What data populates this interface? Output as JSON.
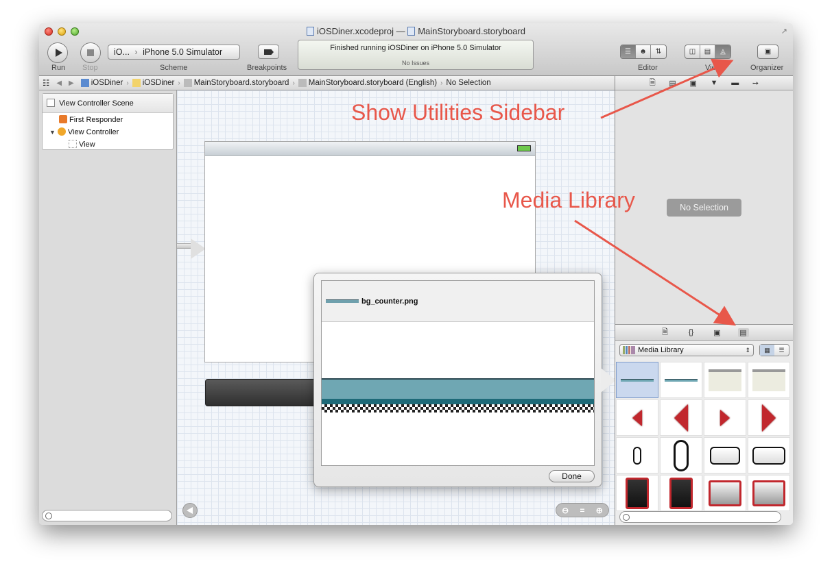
{
  "window": {
    "title_project": "iOSDiner.xcodeproj",
    "title_separator": "—",
    "title_file": "MainStoryboard.storyboard"
  },
  "toolbar": {
    "run_label": "Run",
    "stop_label": "Stop",
    "scheme_target": "iO...",
    "scheme_device": "iPhone 5.0 Simulator",
    "scheme_label": "Scheme",
    "breakpoints_label": "Breakpoints",
    "status_message": "Finished running iOSDiner on iPhone 5.0 Simulator",
    "status_issues": "No Issues",
    "editor_label": "Editor",
    "view_label": "View",
    "organizer_label": "Organizer"
  },
  "jumpbar": {
    "items": [
      "iOSDiner",
      "iOSDiner",
      "MainStoryboard.storyboard",
      "MainStoryboard.storyboard (English)",
      "No Selection"
    ]
  },
  "outline": {
    "scene_title": "View Controller Scene",
    "items": [
      "First Responder",
      "View Controller",
      "View"
    ]
  },
  "popover": {
    "file_name": "bg_counter.png",
    "done_label": "Done"
  },
  "inspector": {
    "empty_text": "No Selection"
  },
  "library": {
    "selected_library": "Media Library"
  },
  "annotations": {
    "utilities": "Show Utilities Sidebar",
    "media": "Media Library",
    "color": "#e8574a"
  },
  "colors": {
    "accent_red": "#c1272d",
    "teal": "#6fa7b3",
    "selection": "#cad8ee"
  }
}
